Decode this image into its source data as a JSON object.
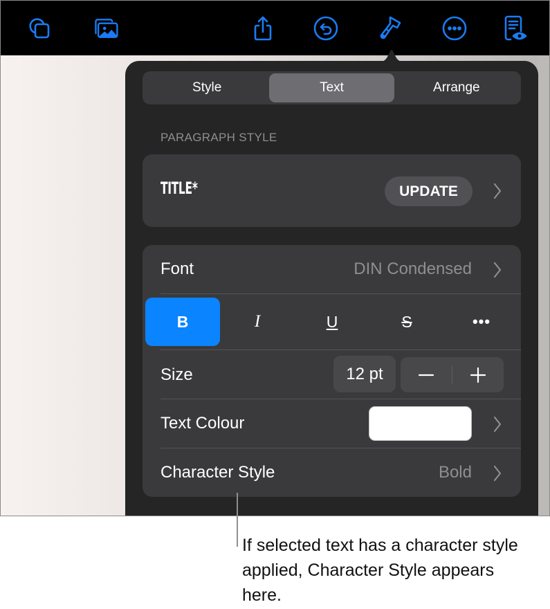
{
  "toolbar": {
    "buttons": [
      {
        "name": "shapes",
        "icon": "shapes-icon"
      },
      {
        "name": "media",
        "icon": "photo-gallery-icon"
      },
      {
        "name": "share",
        "icon": "share-icon"
      },
      {
        "name": "undo",
        "icon": "undo-icon"
      },
      {
        "name": "format",
        "icon": "paintbrush-icon",
        "selected": true
      },
      {
        "name": "more",
        "icon": "ellipsis-circle-icon"
      },
      {
        "name": "reading-view",
        "icon": "document-eye-icon"
      }
    ],
    "accent_color": "#1A7CF5"
  },
  "popover": {
    "tabs": [
      {
        "label": "Style",
        "active": false
      },
      {
        "label": "Text",
        "active": true
      },
      {
        "label": "Arrange",
        "active": false
      }
    ],
    "paragraph_style": {
      "section_label": "PARAGRAPH STYLE",
      "current_style": "TITLE*",
      "update_label": "UPDATE"
    },
    "font": {
      "label": "Font",
      "value": "DIN Condensed"
    },
    "text_styles": [
      {
        "label": "B",
        "name": "bold",
        "active": true
      },
      {
        "label": "I",
        "name": "italic",
        "active": false
      },
      {
        "label": "U",
        "name": "underline",
        "active": false
      },
      {
        "label": "S",
        "name": "strikethrough",
        "active": false
      },
      {
        "label": "•••",
        "name": "more-text-options",
        "active": false
      }
    ],
    "size": {
      "label": "Size",
      "value": "12 pt",
      "decrement": "−",
      "increment": "+"
    },
    "text_colour": {
      "label": "Text Colour",
      "value_color": "#FFFFFF"
    },
    "character_style": {
      "label": "Character Style",
      "value": "Bold"
    },
    "selected_color": "#0A84FF"
  },
  "callout": {
    "text": "If selected text has a character style applied, Character Style appears here."
  }
}
